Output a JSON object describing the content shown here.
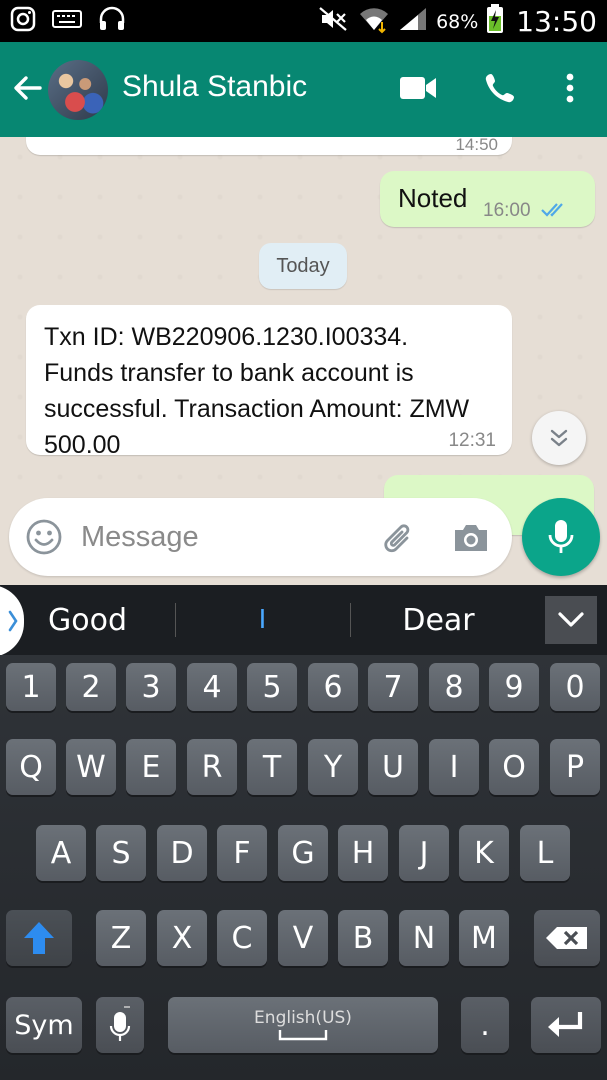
{
  "status_bar": {
    "battery_percent": "68%",
    "time": "13:50"
  },
  "header": {
    "contact_name": "Shula Stanbic"
  },
  "chat": {
    "previous_message_time": "14:50",
    "noted_message": {
      "text": "Noted",
      "time": "16:00"
    },
    "date_divider": "Today",
    "transaction_message": {
      "text": "Txn ID: WB220906.1230.I00334. Funds transfer to bank account is successful. Transaction Amount: ZMW 500.00",
      "time": "12:31"
    }
  },
  "composer": {
    "placeholder": "Message"
  },
  "suggestions": {
    "left": "Good",
    "middle": "I",
    "right": "Dear"
  },
  "keyboard": {
    "number_row": [
      "1",
      "2",
      "3",
      "4",
      "5",
      "6",
      "7",
      "8",
      "9",
      "0"
    ],
    "row1": [
      "Q",
      "W",
      "E",
      "R",
      "T",
      "Y",
      "U",
      "I",
      "O",
      "P"
    ],
    "row2": [
      "A",
      "S",
      "D",
      "F",
      "G",
      "H",
      "J",
      "K",
      "L"
    ],
    "row3": [
      "Z",
      "X",
      "C",
      "V",
      "B",
      "N",
      "M"
    ],
    "sym_label": "Sym",
    "space_label": "English(US)",
    "period_label": "."
  },
  "colors": {
    "header": "#078772",
    "accent": "#0ba58a",
    "outgoing_bubble": "#dcf8c6",
    "incoming_bubble": "#ffffff",
    "read_ticks": "#4fa8e8"
  }
}
